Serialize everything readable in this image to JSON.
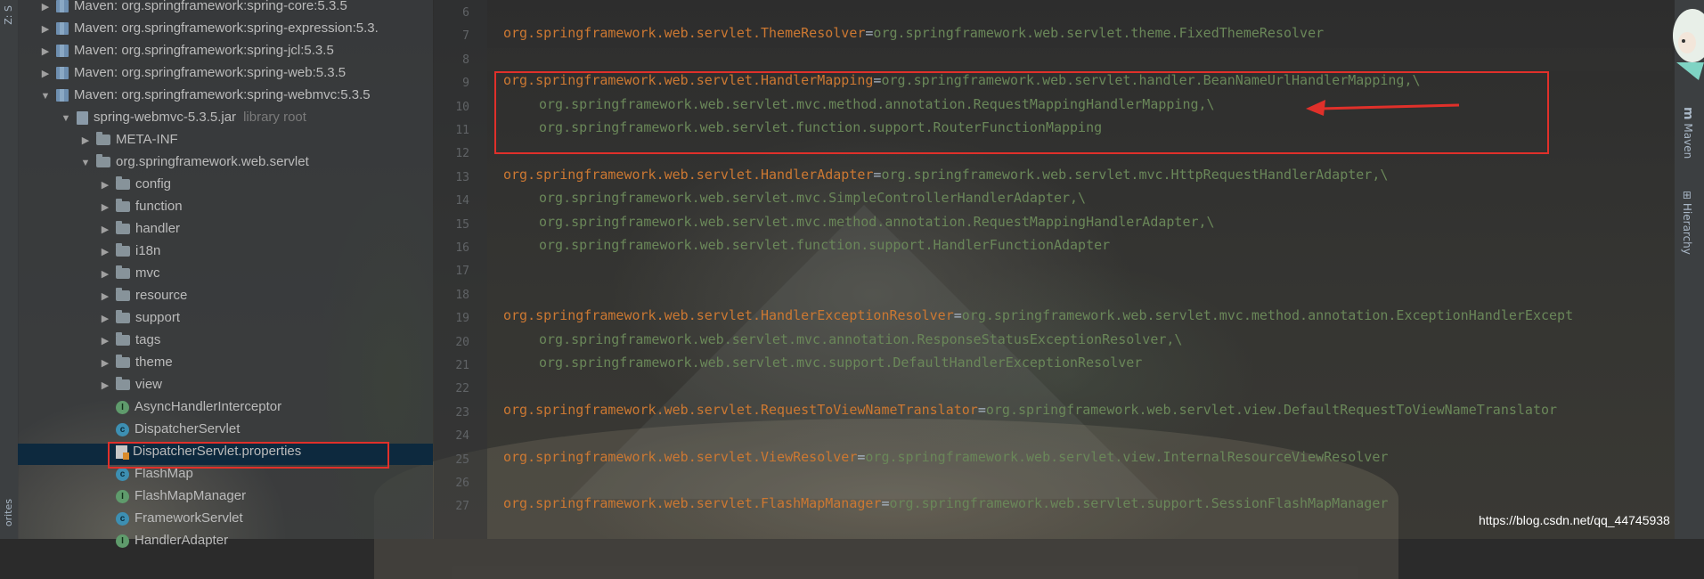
{
  "stripes": {
    "left_top_label": "Z: S",
    "left_bottom_label": "orites",
    "right_maven_label": "Maven",
    "right_hierarchy_label": "Hierarchy"
  },
  "project_tree": [
    {
      "label": "Maven: org.springframework:spring-core:5.3.5",
      "arrow": "▶",
      "icon": "lib"
    },
    {
      "label": "Maven: org.springframework:spring-expression:5.3.",
      "arrow": "▶",
      "icon": "lib"
    },
    {
      "label": "Maven: org.springframework:spring-jcl:5.3.5",
      "arrow": "▶",
      "icon": "lib"
    },
    {
      "label": "Maven: org.springframework:spring-web:5.3.5",
      "arrow": "▶",
      "icon": "lib"
    },
    {
      "label": "Maven: org.springframework:spring-webmvc:5.3.5",
      "arrow": "▼",
      "icon": "lib"
    },
    {
      "label": "spring-webmvc-5.3.5.jar",
      "suffix": "library root",
      "arrow": "▼",
      "icon": "jar"
    },
    {
      "label": "META-INF",
      "arrow": "▶",
      "icon": "folder"
    },
    {
      "label": "org.springframework.web.servlet",
      "arrow": "▼",
      "icon": "folder"
    },
    {
      "label": "config",
      "arrow": "▶",
      "icon": "folder"
    },
    {
      "label": "function",
      "arrow": "▶",
      "icon": "folder"
    },
    {
      "label": "handler",
      "arrow": "▶",
      "icon": "folder"
    },
    {
      "label": "i18n",
      "arrow": "▶",
      "icon": "folder"
    },
    {
      "label": "mvc",
      "arrow": "▶",
      "icon": "folder"
    },
    {
      "label": "resource",
      "arrow": "▶",
      "icon": "folder"
    },
    {
      "label": "support",
      "arrow": "▶",
      "icon": "folder"
    },
    {
      "label": "tags",
      "arrow": "▶",
      "icon": "folder"
    },
    {
      "label": "theme",
      "arrow": "▶",
      "icon": "folder"
    },
    {
      "label": "view",
      "arrow": "▶",
      "icon": "folder"
    },
    {
      "label": "AsyncHandlerInterceptor",
      "arrow": "",
      "icon": "interface"
    },
    {
      "label": "DispatcherServlet",
      "arrow": "",
      "icon": "class"
    },
    {
      "label": "DispatcherServlet.properties",
      "arrow": "",
      "icon": "properties",
      "selected": true
    },
    {
      "label": "FlashMap",
      "arrow": "",
      "icon": "class"
    },
    {
      "label": "FlashMapManager",
      "arrow": "",
      "icon": "interface"
    },
    {
      "label": "FrameworkServlet",
      "arrow": "",
      "icon": "class"
    },
    {
      "label": "HandlerAdapter",
      "arrow": "",
      "icon": "interface"
    }
  ],
  "editor_lines": [
    {
      "n": "6",
      "key": "",
      "val": ""
    },
    {
      "n": "7",
      "key": "org.springframework.web.servlet.ThemeResolver",
      "eq": "=",
      "val": "org.springframework.web.servlet.theme.FixedThemeResolver"
    },
    {
      "n": "8",
      "key": "",
      "val": ""
    },
    {
      "n": "9",
      "key": "org.springframework.web.servlet.HandlerMapping",
      "eq": "=",
      "val": "org.springframework.web.servlet.handler.BeanNameUrlHandlerMapping,\\"
    },
    {
      "n": "10",
      "key": "",
      "val": "org.springframework.web.servlet.mvc.method.annotation.RequestMappingHandlerMapping,\\",
      "indent": true
    },
    {
      "n": "11",
      "key": "",
      "val": "org.springframework.web.servlet.function.support.RouterFunctionMapping",
      "indent": true
    },
    {
      "n": "12",
      "key": "",
      "val": ""
    },
    {
      "n": "13",
      "key": "org.springframework.web.servlet.HandlerAdapter",
      "eq": "=",
      "val": "org.springframework.web.servlet.mvc.HttpRequestHandlerAdapter,\\"
    },
    {
      "n": "14",
      "key": "",
      "val": "org.springframework.web.servlet.mvc.SimpleControllerHandlerAdapter,\\",
      "indent": true
    },
    {
      "n": "15",
      "key": "",
      "val": "org.springframework.web.servlet.mvc.method.annotation.RequestMappingHandlerAdapter,\\",
      "indent": true
    },
    {
      "n": "16",
      "key": "",
      "val": "org.springframework.web.servlet.function.support.HandlerFunctionAdapter",
      "indent": true
    },
    {
      "n": "17",
      "key": "",
      "val": ""
    },
    {
      "n": "18",
      "key": "",
      "val": ""
    },
    {
      "n": "19",
      "key": "org.springframework.web.servlet.HandlerExceptionResolver",
      "eq": "=",
      "val": "org.springframework.web.servlet.mvc.method.annotation.ExceptionHandlerExcept"
    },
    {
      "n": "20",
      "key": "",
      "val": "org.springframework.web.servlet.mvc.annotation.ResponseStatusExceptionResolver,\\",
      "indent": true
    },
    {
      "n": "21",
      "key": "",
      "val": "org.springframework.web.servlet.mvc.support.DefaultHandlerExceptionResolver",
      "indent": true
    },
    {
      "n": "22",
      "key": "",
      "val": ""
    },
    {
      "n": "23",
      "key": "org.springframework.web.servlet.RequestToViewNameTranslator",
      "eq": "=",
      "val": "org.springframework.web.servlet.view.DefaultRequestToViewNameTranslator"
    },
    {
      "n": "24",
      "key": "",
      "val": ""
    },
    {
      "n": "25",
      "key": "org.springframework.web.servlet.ViewResolver",
      "eq": "=",
      "val": "org.springframework.web.servlet.view.InternalResourceViewResolver"
    },
    {
      "n": "26",
      "key": "",
      "val": ""
    },
    {
      "n": "27",
      "key": "org.springframework.web.servlet.FlashMapManager",
      "eq": "=",
      "val": "org.springframework.web.servlet.support.SessionFlashMapManager"
    }
  ],
  "watermark": "https://blog.csdn.net/qq_44745938",
  "colors": {
    "key": "#cc7832",
    "value": "#6a8759",
    "highlight_box": "#e0302a",
    "selection": "#0d293e"
  }
}
